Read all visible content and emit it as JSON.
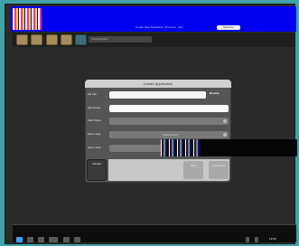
{
  "window": {
    "title": "Create New Application (Process) - Sun",
    "title_button": "Minimize"
  },
  "toolbar": {
    "path_text": "/Configuration"
  },
  "dialog": {
    "title": "Create Application",
    "rows": [
      {
        "label": "Zip File",
        "value": ""
      },
      {
        "label": "App Name",
        "value": ""
      },
      {
        "label": "Main Class",
        "value": ""
      },
      {
        "label": "Main Lang",
        "value": "Java(default)"
      },
      {
        "label": "User Level",
        "value": ""
      }
    ],
    "browse_label": "Browse",
    "cancel_label": "Cancel",
    "next_label": "Next",
    "create_label": "Create\nApp"
  },
  "taskbar": {
    "clock": "12:00"
  },
  "colors": {
    "desktop": "#3fa3a7",
    "titlebar": "#0000f0",
    "dialog_header": "#cfcfcf"
  }
}
